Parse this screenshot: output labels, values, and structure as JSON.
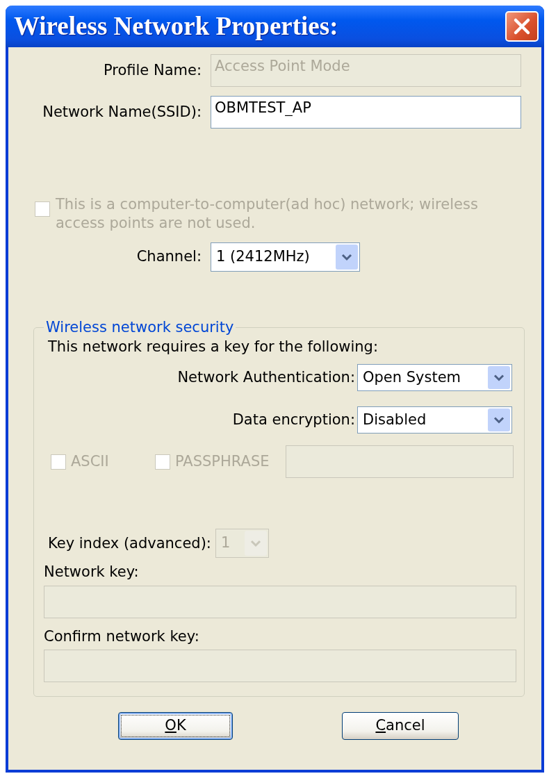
{
  "window": {
    "title": "Wireless Network Properties:"
  },
  "fields": [
    {
      "label": "Profile Name:",
      "value": "Access Point Mode",
      "disabled": true
    },
    {
      "label": "Network Name(SSID):",
      "value": "OBMTEST_AP",
      "disabled": false
    }
  ],
  "adhoc": {
    "label": "This is a computer-to-computer(ad hoc) network; wireless access points are not used.",
    "checked": false,
    "disabled": true
  },
  "channel": {
    "label": "Channel:",
    "value": "1 (2412MHz)",
    "disabled": false
  },
  "security": {
    "title": "Wireless network security",
    "intro": "This network requires a key for the following:",
    "selects": [
      {
        "label": "Network Authentication:",
        "value": "Open System",
        "disabled": false
      },
      {
        "label": "Data encryption:",
        "value": "Disabled",
        "disabled": false
      }
    ],
    "options": [
      {
        "label": "ASCII",
        "checked": false,
        "disabled": true
      },
      {
        "label": "PASSPHRASE",
        "checked": false,
        "disabled": true
      }
    ],
    "passphrase_field": {
      "disabled": true
    },
    "key_index": {
      "label": "Key index (advanced):",
      "value": "1",
      "disabled": true
    },
    "keys": [
      {
        "label": "Network key:",
        "disabled": true
      },
      {
        "label": "Confirm network key:",
        "disabled": true
      }
    ]
  },
  "buttons": [
    {
      "label": "OK",
      "access_key_underlined": true,
      "default": true
    },
    {
      "label": "Cancel",
      "access_key_underlined": true,
      "default": false
    }
  ]
}
